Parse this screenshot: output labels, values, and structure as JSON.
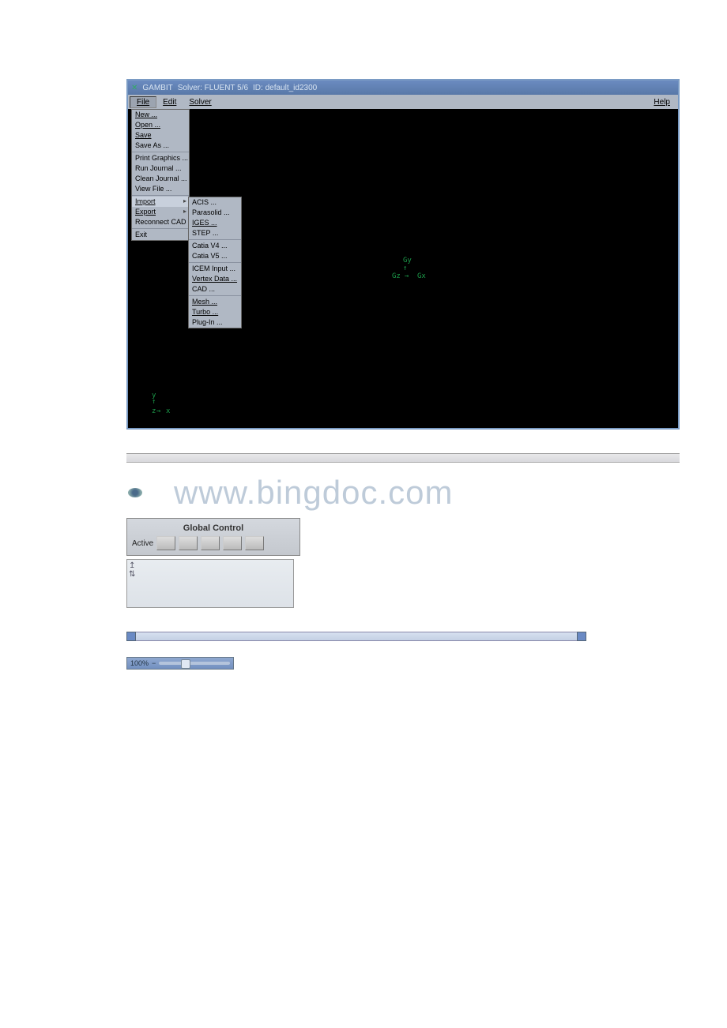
{
  "titlebar": {
    "app": "GAMBIT",
    "solver": "Solver: FLUENT 5/6",
    "id": "ID: default_id2300"
  },
  "menubar": {
    "file": "File",
    "edit": "Edit",
    "solver": "Solver",
    "help": "Help"
  },
  "filemenu": {
    "new": "New ...",
    "open": "Open ...",
    "save": "Save",
    "saveas": "Save As ...",
    "printg": "Print Graphics ...",
    "runj": "Run Journal ...",
    "cleanj": "Clean Journal ...",
    "viewf": "View File ...",
    "import": "Import",
    "export": "Export",
    "reconnect": "Reconnect CAD",
    "exit": "Exit"
  },
  "submenu": {
    "acis": "ACIS ...",
    "parasolid": "Parasolid ...",
    "iges": "IGES ...",
    "step": "STEP ...",
    "catiav4": "Catia V4 ...",
    "catiav5": "Catia V5 ...",
    "icem": "ICEM Input ...",
    "vertex": "Vertex Data ...",
    "cad": "CAD ...",
    "mesh": "Mesh ...",
    "turbo": "Turbo ...",
    "plugin": "Plug-In ..."
  },
  "axis": {
    "x": "x",
    "y": "y",
    "z": "z"
  },
  "axis_center": {
    "gx": "Gx",
    "gy": "Gy",
    "gz": "Gz"
  },
  "watermark": "www.bingdoc.com",
  "global_control": {
    "title": "Global Control",
    "active": "Active"
  },
  "zoom": {
    "value": "100%"
  }
}
